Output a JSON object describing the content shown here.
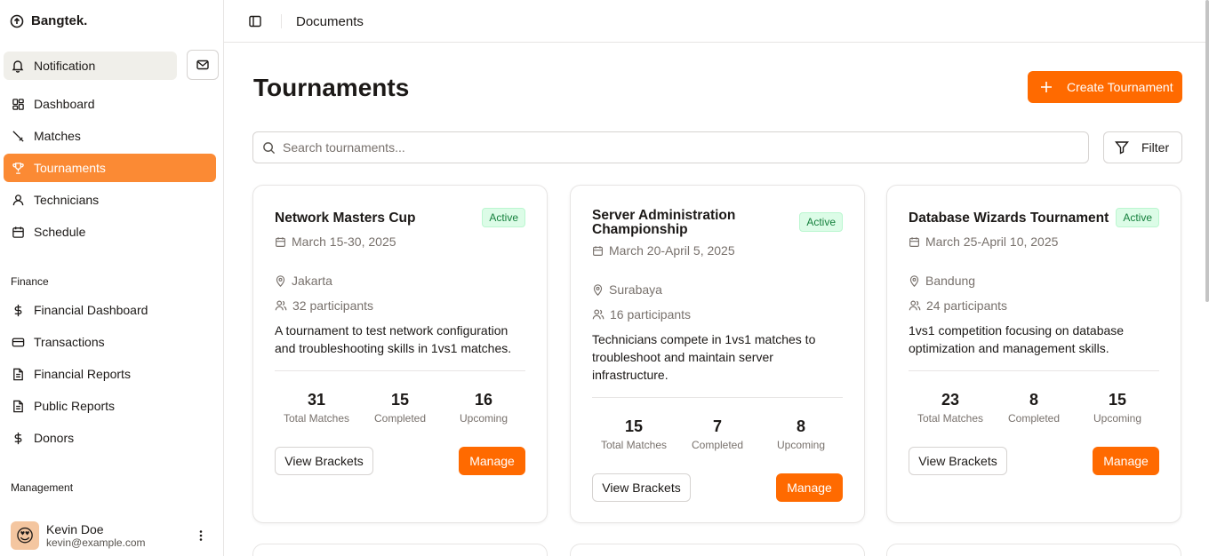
{
  "brand": {
    "name": "Bangtek."
  },
  "sidebar": {
    "notification_label": "Notification",
    "main_items": [
      {
        "label": "Dashboard",
        "icon": "grid-icon"
      },
      {
        "label": "Matches",
        "icon": "swords-icon"
      },
      {
        "label": "Tournaments",
        "icon": "trophy-icon",
        "active": true
      },
      {
        "label": "Technicians",
        "icon": "user-icon"
      },
      {
        "label": "Schedule",
        "icon": "calendar-icon"
      }
    ],
    "finance_label": "Finance",
    "finance_items": [
      {
        "label": "Financial Dashboard",
        "icon": "dollar-icon"
      },
      {
        "label": "Transactions",
        "icon": "credit-card-icon"
      },
      {
        "label": "Financial Reports",
        "icon": "file-text-icon"
      },
      {
        "label": "Public Reports",
        "icon": "file-text-icon"
      },
      {
        "label": "Donors",
        "icon": "dollar-icon"
      }
    ],
    "management_label": "Management",
    "user": {
      "name": "Kevin Doe",
      "email": "kevin@example.com",
      "avatar": "😍"
    }
  },
  "topbar": {
    "breadcrumb": "Documents"
  },
  "main": {
    "title": "Tournaments",
    "create_label": "Create Tournament",
    "search_placeholder": "Search tournaments...",
    "filter_label": "Filter"
  },
  "tournaments": [
    {
      "title": "Network Masters Cup",
      "status": "Active",
      "dates": "March 15-30, 2025",
      "location": "Jakarta",
      "participants": "32 participants",
      "description": "A tournament to test network configuration and troubleshooting skills in 1vs1 matches.",
      "stats": [
        {
          "value": "31",
          "label": "Total Matches"
        },
        {
          "value": "15",
          "label": "Completed"
        },
        {
          "value": "16",
          "label": "Upcoming"
        }
      ],
      "view_label": "View Brackets",
      "manage_label": "Manage"
    },
    {
      "title": "Server Administration Championship",
      "status": "Active",
      "dates": "March 20-April 5, 2025",
      "location": "Surabaya",
      "participants": "16 participants",
      "description": "Technicians compete in 1vs1 matches to troubleshoot and maintain server infrastructure.",
      "stats": [
        {
          "value": "15",
          "label": "Total Matches"
        },
        {
          "value": "7",
          "label": "Completed"
        },
        {
          "value": "8",
          "label": "Upcoming"
        }
      ],
      "view_label": "View Brackets",
      "manage_label": "Manage"
    },
    {
      "title": "Database Wizards Tournament",
      "status": "Active",
      "dates": "March 25-April 10, 2025",
      "location": "Bandung",
      "participants": "24 participants",
      "description": "1vs1 competition focusing on database optimization and management skills.",
      "stats": [
        {
          "value": "23",
          "label": "Total Matches"
        },
        {
          "value": "8",
          "label": "Completed"
        },
        {
          "value": "15",
          "label": "Upcoming"
        }
      ],
      "view_label": "View Brackets",
      "manage_label": "Manage"
    }
  ],
  "colors": {
    "accent": "#ff6a00",
    "active_nav": "#fb8a34",
    "badge_bg": "#dcfce7",
    "badge_text": "#15803d"
  }
}
